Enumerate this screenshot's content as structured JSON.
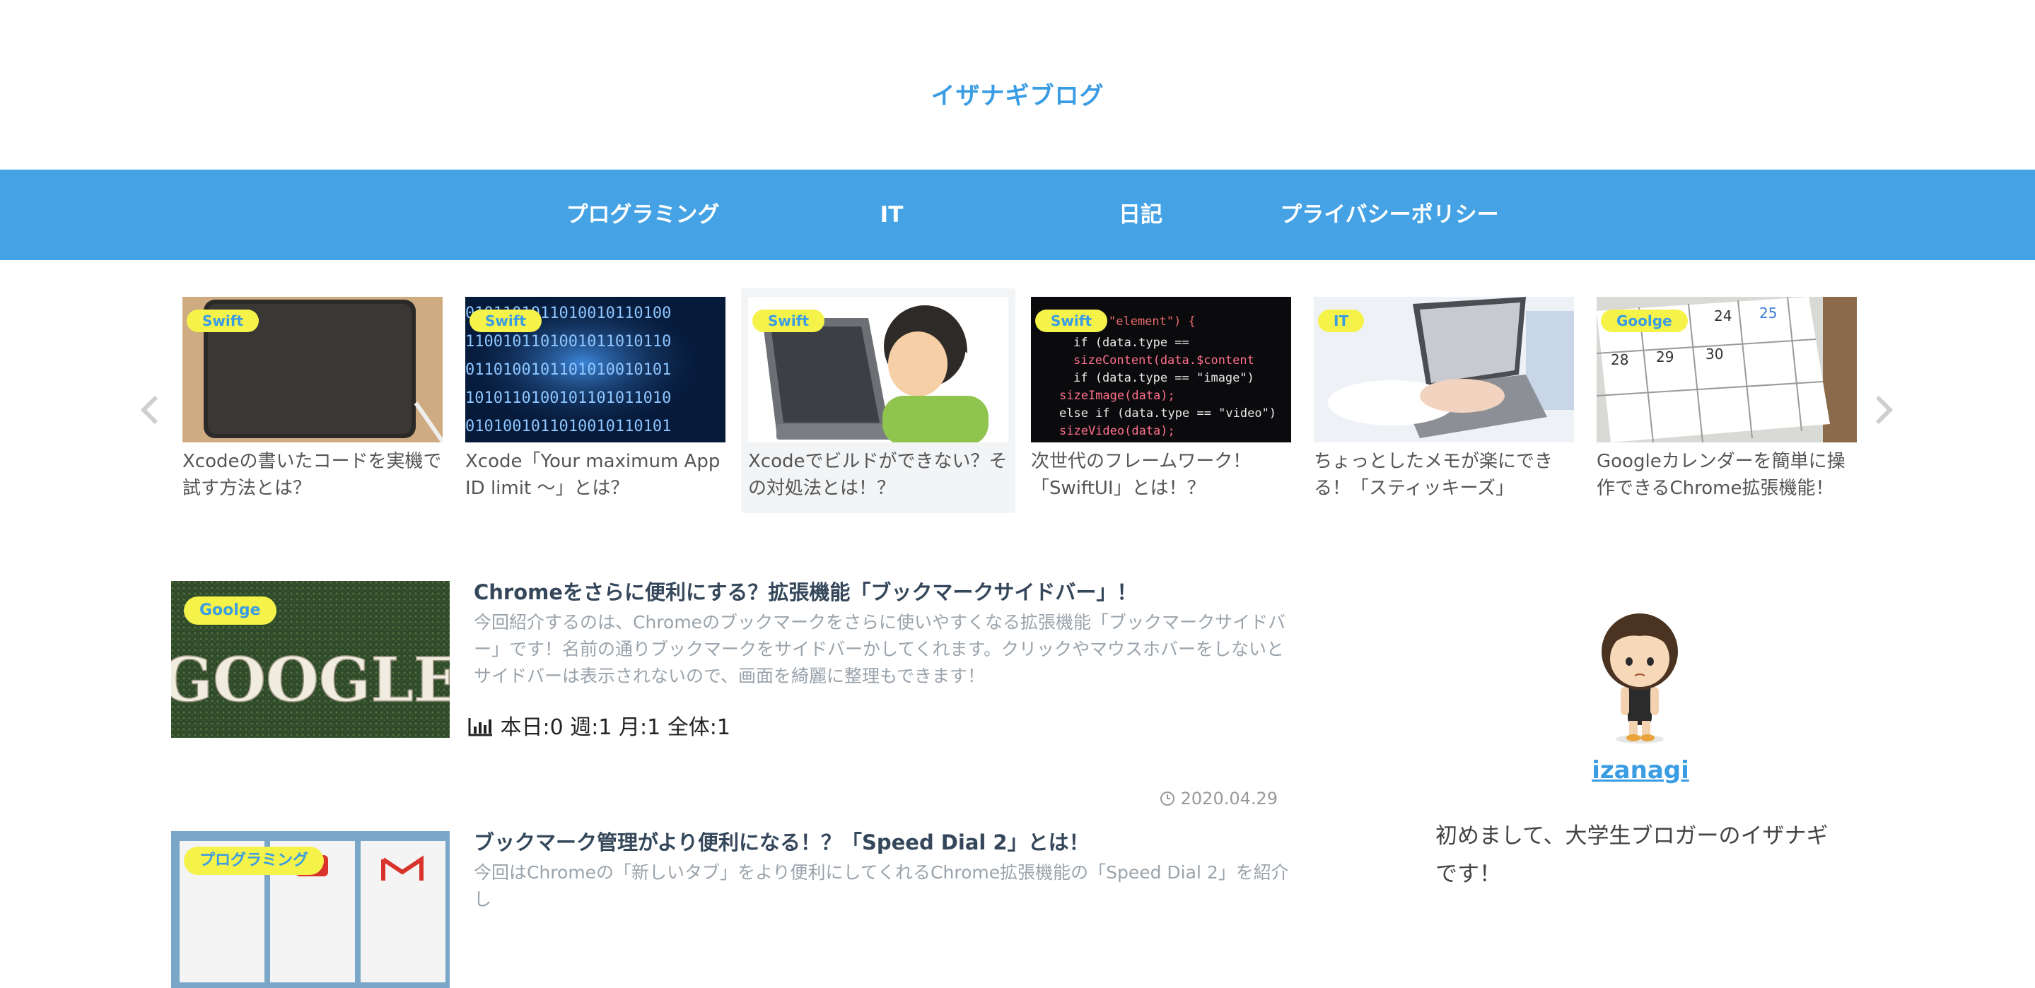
{
  "site": {
    "title": "イザナギブログ"
  },
  "nav": {
    "items": [
      "プログラミング",
      "IT",
      "日記",
      "プライバシーポリシー"
    ]
  },
  "slider": {
    "prev_icon": "chevron-left-icon",
    "next_icon": "chevron-right-icon",
    "slides": [
      {
        "category": "Swift",
        "title": "Xcodeの書いたコードを実機で試す方法とは？"
      },
      {
        "category": "Swift",
        "title": "Xcode「Your maximum App ID limit 〜」とは？"
      },
      {
        "category": "Swift",
        "title": "Xcodeでビルドができない？その対処法とは！？"
      },
      {
        "category": "Swift",
        "title": "次世代のフレームワーク！「SwiftUI」とは！？"
      },
      {
        "category": "IT",
        "title": "ちょっとしたメモが楽にできる！「スティッキーズ」"
      },
      {
        "category": "Goolge",
        "title": "Googleカレンダーを簡単に操作できるChrome拡張機能！"
      }
    ]
  },
  "posts": [
    {
      "category": "Goolge",
      "thumb_text": "GOOGLE",
      "title": "Chromeをさらに便利にする？拡張機能「ブックマークサイドバー」！",
      "excerpt": "今回紹介するのは、Chromeのブックマークをさらに使いやすくなる拡張機能「ブックマークサイドバー」です！名前の通りブックマークをサイドバーかしてくれます。クリックやマウスホバーをしないとサイドバーは表示されないので、画面を綺麗に整理もできます！",
      "stats": "本日:0  週:1  月:1  全体:1",
      "date": "2020.04.29"
    },
    {
      "category": "プログラミング",
      "title": "ブックマーク管理がより便利になる！？「Speed Dial 2」とは！",
      "excerpt": "今回はChromeの「新しいタブ」をより便利にしてくれるChrome拡張機能の「Speed Dial 2」を紹介し"
    }
  ],
  "sidebar": {
    "author_name": "izanagi",
    "bio": "初めまして、大学生ブロガーのイザナギです！"
  },
  "colors": {
    "accent": "#45a3e5",
    "title_blue": "#3a9ce3",
    "badge_yellow": "#f5f24a"
  }
}
